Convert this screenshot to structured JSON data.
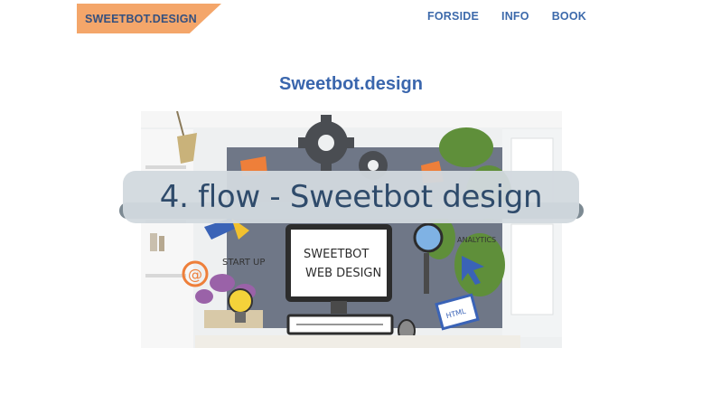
{
  "header": {
    "logo_text": "SWEETBOT.DESIGN",
    "nav": [
      {
        "label": "FORSIDE"
      },
      {
        "label": "INFO"
      },
      {
        "label": "BOOK"
      }
    ]
  },
  "main": {
    "title": "Sweetbot.design",
    "hero": {
      "caption": "4. flow - Sweetbot design",
      "monitor_text_line1": "SWEETBOT",
      "monitor_text_line2": "WEB DESIGN",
      "label_startup": "START UP",
      "label_analytics": "ANALYTICS",
      "label_html": "HTML"
    }
  },
  "colors": {
    "logo_bg": "#f4a66a",
    "logo_text": "#34507f",
    "nav_link": "#3d6aab",
    "title": "#3a66ad",
    "caption_bg": "#d2d9de",
    "caption_text": "#2f4b6b"
  }
}
